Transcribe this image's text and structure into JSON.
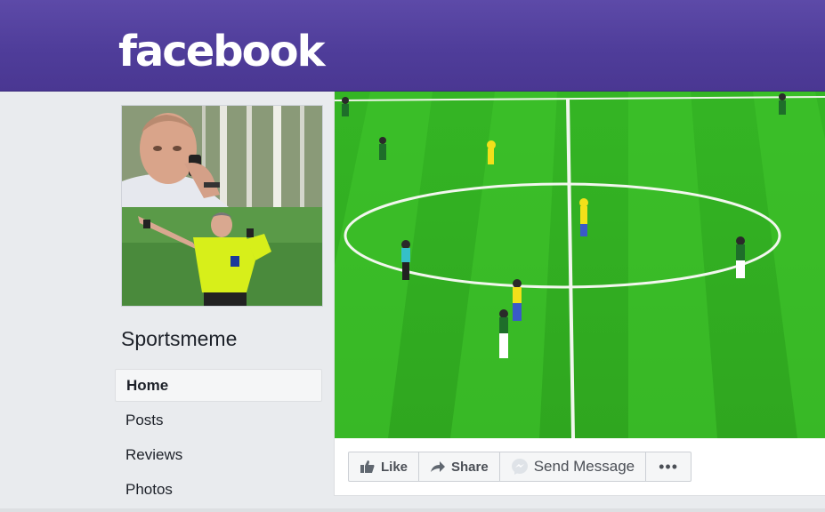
{
  "header": {
    "logo_text": "facebook",
    "brand_color": "#4f3d9a"
  },
  "page": {
    "name": "Sportsmeme"
  },
  "nav": {
    "items": [
      {
        "label": "Home",
        "active": true
      },
      {
        "label": "Posts"
      },
      {
        "label": "Reviews"
      },
      {
        "label": "Photos"
      }
    ]
  },
  "actions": {
    "like_label": "Like",
    "share_label": "Share",
    "message_label": "Send Message",
    "more_label": "•••",
    "icons": [
      "thumbs-up-icon",
      "share-arrow-icon",
      "messenger-icon",
      "more-icon"
    ]
  },
  "colors": {
    "field_green": "#3cb82a",
    "line_white": "#f2f7ee"
  }
}
